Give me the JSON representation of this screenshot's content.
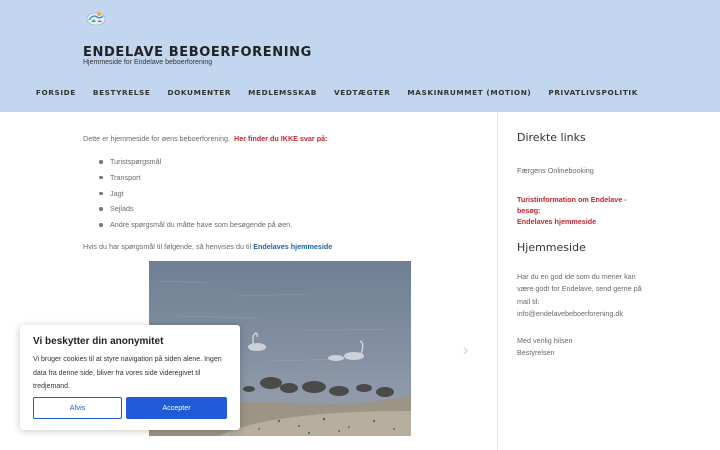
{
  "header": {
    "site_title": "ENDELAVE BEBOERFORENING",
    "tagline": "Hjemmeside for Endelave beboerforening",
    "nav": [
      "FORSIDE",
      "BESTYRELSE",
      "DOKUMENTER",
      "MEDLEMSSKAB",
      "VEDTÆGTER",
      "MASKINRUMMET (MOTION)",
      "PRIVATLIVSPOLITIK"
    ]
  },
  "main": {
    "intro_text": "Dette er hjemmeside for øens beboerforening.",
    "intro_red": "Her finder du IKKE svar på:",
    "bullets": [
      "Turistspørgsmål",
      "Transport",
      "Jagt",
      "Sejlads",
      "Andre spørgsmål du måtte have som besøgende på øen."
    ],
    "questions_text": "Hvis du har spørgsmål til følgende, så henvises du til",
    "questions_link": "Endelaves hjemmeside",
    "next_arrow": "›"
  },
  "sidebar": {
    "direct_links_heading": "Direkte links",
    "ferry_link": "Færgens Onlinebooking",
    "tourist_info_line1": "Turistinformation om Endelave -",
    "tourist_info_line2": "besøg:",
    "tourist_info_line3": "Endelaves hjemmeside",
    "homepage_heading": "Hjemmeside",
    "homepage_text": "Har du en god ide som du mener kan være godt for Endelave, send gerne på mail til: info@endelavebeboerforening.dk",
    "sign_line1": "Med venlig hilsen",
    "sign_line2": "Bestyrelsen"
  },
  "cookie": {
    "title": "Vi beskytter din anonymitet",
    "text": "Vi bruger cookies til at styre navigation på siden alene. Ingen data fra denne side, bliver fra vores side videregivet til tredjemand.",
    "deny_label": "Afvis",
    "accept_label": "Accepter"
  },
  "colors": {
    "header_bg": "#c3d6ef",
    "red_accent": "#c0272d",
    "link_blue": "#1d62a8",
    "button_blue": "#1f5bd8"
  }
}
